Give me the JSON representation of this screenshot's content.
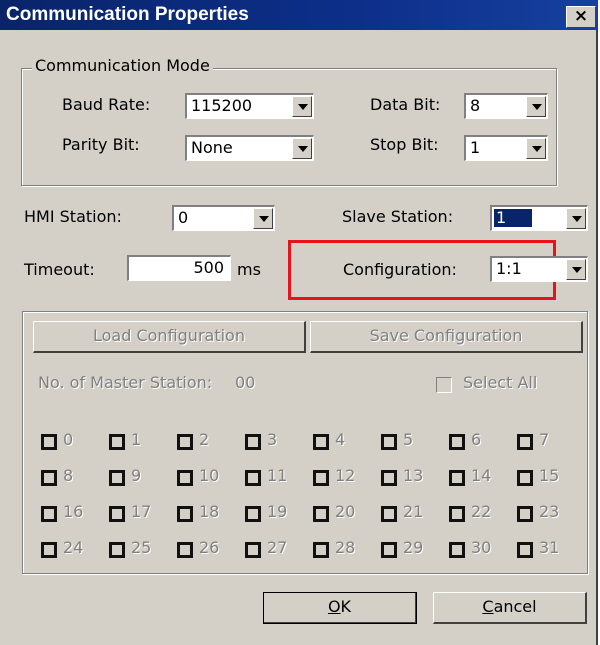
{
  "window": {
    "title": "Communication Properties",
    "close_glyph": "×"
  },
  "comm_mode": {
    "legend": "Communication Mode",
    "baud_rate": {
      "label": "Baud Rate:",
      "value": "115200"
    },
    "data_bit": {
      "label": "Data Bit:",
      "value": "8"
    },
    "parity_bit": {
      "label": "Parity Bit:",
      "value": "None"
    },
    "stop_bit": {
      "label": "Stop Bit:",
      "value": "1"
    }
  },
  "hmi_station": {
    "label": "HMI Station:",
    "value": "0"
  },
  "slave_station": {
    "label": "Slave Station:",
    "value": "1"
  },
  "timeout": {
    "label": "Timeout:",
    "value": "500",
    "unit": "ms"
  },
  "configuration": {
    "label": "Configuration:",
    "value": "1:1"
  },
  "master": {
    "load_button": "Load Configuration",
    "save_button": "Save Configuration",
    "count_label": "No. of Master Station:",
    "count_value": "00",
    "select_all": "Select All",
    "stations": [
      "0",
      "1",
      "2",
      "3",
      "4",
      "5",
      "6",
      "7",
      "8",
      "9",
      "10",
      "11",
      "12",
      "13",
      "14",
      "15",
      "16",
      "17",
      "18",
      "19",
      "20",
      "21",
      "22",
      "23",
      "24",
      "25",
      "26",
      "27",
      "28",
      "29",
      "30",
      "31"
    ]
  },
  "buttons": {
    "ok_hotkey": "O",
    "ok_rest": "K",
    "cancel_hotkey": "C",
    "cancel_rest": "ancel"
  },
  "colors": {
    "title_bar": "#0a246a",
    "highlight_box": "#e8121b",
    "face": "#d4d0c8"
  },
  "icons": [
    "close-icon",
    "dropdown-arrow-icon",
    "checkbox-icon"
  ]
}
